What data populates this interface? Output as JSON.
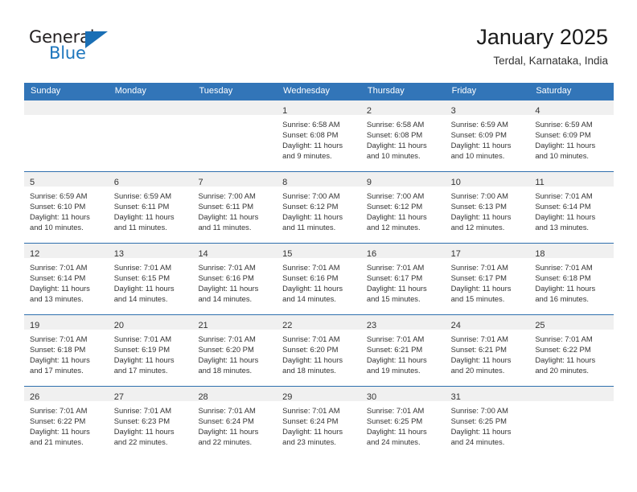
{
  "logo": {
    "word_top": "General",
    "word_bottom": "Blue",
    "triangle_icon": "triangle-right-icon",
    "accent_color": "#1a6fb5"
  },
  "header": {
    "title": "January 2025",
    "subtitle": "Terdal, Karnataka, India"
  },
  "theme": {
    "header_row_bg": "#3275b8",
    "week_separator": "#2f6fae",
    "daynum_band_bg": "#f0f0f0",
    "text": "#333333"
  },
  "weekday_headers": [
    "Sunday",
    "Monday",
    "Tuesday",
    "Wednesday",
    "Thursday",
    "Friday",
    "Saturday"
  ],
  "weeks": [
    [
      {
        "day": "",
        "lines": []
      },
      {
        "day": "",
        "lines": []
      },
      {
        "day": "",
        "lines": []
      },
      {
        "day": "1",
        "lines": [
          "Sunrise: 6:58 AM",
          "Sunset: 6:08 PM",
          "Daylight: 11 hours",
          "and 9 minutes."
        ]
      },
      {
        "day": "2",
        "lines": [
          "Sunrise: 6:58 AM",
          "Sunset: 6:08 PM",
          "Daylight: 11 hours",
          "and 10 minutes."
        ]
      },
      {
        "day": "3",
        "lines": [
          "Sunrise: 6:59 AM",
          "Sunset: 6:09 PM",
          "Daylight: 11 hours",
          "and 10 minutes."
        ]
      },
      {
        "day": "4",
        "lines": [
          "Sunrise: 6:59 AM",
          "Sunset: 6:09 PM",
          "Daylight: 11 hours",
          "and 10 minutes."
        ]
      }
    ],
    [
      {
        "day": "5",
        "lines": [
          "Sunrise: 6:59 AM",
          "Sunset: 6:10 PM",
          "Daylight: 11 hours",
          "and 10 minutes."
        ]
      },
      {
        "day": "6",
        "lines": [
          "Sunrise: 6:59 AM",
          "Sunset: 6:11 PM",
          "Daylight: 11 hours",
          "and 11 minutes."
        ]
      },
      {
        "day": "7",
        "lines": [
          "Sunrise: 7:00 AM",
          "Sunset: 6:11 PM",
          "Daylight: 11 hours",
          "and 11 minutes."
        ]
      },
      {
        "day": "8",
        "lines": [
          "Sunrise: 7:00 AM",
          "Sunset: 6:12 PM",
          "Daylight: 11 hours",
          "and 11 minutes."
        ]
      },
      {
        "day": "9",
        "lines": [
          "Sunrise: 7:00 AM",
          "Sunset: 6:12 PM",
          "Daylight: 11 hours",
          "and 12 minutes."
        ]
      },
      {
        "day": "10",
        "lines": [
          "Sunrise: 7:00 AM",
          "Sunset: 6:13 PM",
          "Daylight: 11 hours",
          "and 12 minutes."
        ]
      },
      {
        "day": "11",
        "lines": [
          "Sunrise: 7:01 AM",
          "Sunset: 6:14 PM",
          "Daylight: 11 hours",
          "and 13 minutes."
        ]
      }
    ],
    [
      {
        "day": "12",
        "lines": [
          "Sunrise: 7:01 AM",
          "Sunset: 6:14 PM",
          "Daylight: 11 hours",
          "and 13 minutes."
        ]
      },
      {
        "day": "13",
        "lines": [
          "Sunrise: 7:01 AM",
          "Sunset: 6:15 PM",
          "Daylight: 11 hours",
          "and 14 minutes."
        ]
      },
      {
        "day": "14",
        "lines": [
          "Sunrise: 7:01 AM",
          "Sunset: 6:16 PM",
          "Daylight: 11 hours",
          "and 14 minutes."
        ]
      },
      {
        "day": "15",
        "lines": [
          "Sunrise: 7:01 AM",
          "Sunset: 6:16 PM",
          "Daylight: 11 hours",
          "and 14 minutes."
        ]
      },
      {
        "day": "16",
        "lines": [
          "Sunrise: 7:01 AM",
          "Sunset: 6:17 PM",
          "Daylight: 11 hours",
          "and 15 minutes."
        ]
      },
      {
        "day": "17",
        "lines": [
          "Sunrise: 7:01 AM",
          "Sunset: 6:17 PM",
          "Daylight: 11 hours",
          "and 15 minutes."
        ]
      },
      {
        "day": "18",
        "lines": [
          "Sunrise: 7:01 AM",
          "Sunset: 6:18 PM",
          "Daylight: 11 hours",
          "and 16 minutes."
        ]
      }
    ],
    [
      {
        "day": "19",
        "lines": [
          "Sunrise: 7:01 AM",
          "Sunset: 6:18 PM",
          "Daylight: 11 hours",
          "and 17 minutes."
        ]
      },
      {
        "day": "20",
        "lines": [
          "Sunrise: 7:01 AM",
          "Sunset: 6:19 PM",
          "Daylight: 11 hours",
          "and 17 minutes."
        ]
      },
      {
        "day": "21",
        "lines": [
          "Sunrise: 7:01 AM",
          "Sunset: 6:20 PM",
          "Daylight: 11 hours",
          "and 18 minutes."
        ]
      },
      {
        "day": "22",
        "lines": [
          "Sunrise: 7:01 AM",
          "Sunset: 6:20 PM",
          "Daylight: 11 hours",
          "and 18 minutes."
        ]
      },
      {
        "day": "23",
        "lines": [
          "Sunrise: 7:01 AM",
          "Sunset: 6:21 PM",
          "Daylight: 11 hours",
          "and 19 minutes."
        ]
      },
      {
        "day": "24",
        "lines": [
          "Sunrise: 7:01 AM",
          "Sunset: 6:21 PM",
          "Daylight: 11 hours",
          "and 20 minutes."
        ]
      },
      {
        "day": "25",
        "lines": [
          "Sunrise: 7:01 AM",
          "Sunset: 6:22 PM",
          "Daylight: 11 hours",
          "and 20 minutes."
        ]
      }
    ],
    [
      {
        "day": "26",
        "lines": [
          "Sunrise: 7:01 AM",
          "Sunset: 6:22 PM",
          "Daylight: 11 hours",
          "and 21 minutes."
        ]
      },
      {
        "day": "27",
        "lines": [
          "Sunrise: 7:01 AM",
          "Sunset: 6:23 PM",
          "Daylight: 11 hours",
          "and 22 minutes."
        ]
      },
      {
        "day": "28",
        "lines": [
          "Sunrise: 7:01 AM",
          "Sunset: 6:24 PM",
          "Daylight: 11 hours",
          "and 22 minutes."
        ]
      },
      {
        "day": "29",
        "lines": [
          "Sunrise: 7:01 AM",
          "Sunset: 6:24 PM",
          "Daylight: 11 hours",
          "and 23 minutes."
        ]
      },
      {
        "day": "30",
        "lines": [
          "Sunrise: 7:01 AM",
          "Sunset: 6:25 PM",
          "Daylight: 11 hours",
          "and 24 minutes."
        ]
      },
      {
        "day": "31",
        "lines": [
          "Sunrise: 7:00 AM",
          "Sunset: 6:25 PM",
          "Daylight: 11 hours",
          "and 24 minutes."
        ]
      },
      {
        "day": "",
        "lines": []
      }
    ]
  ]
}
